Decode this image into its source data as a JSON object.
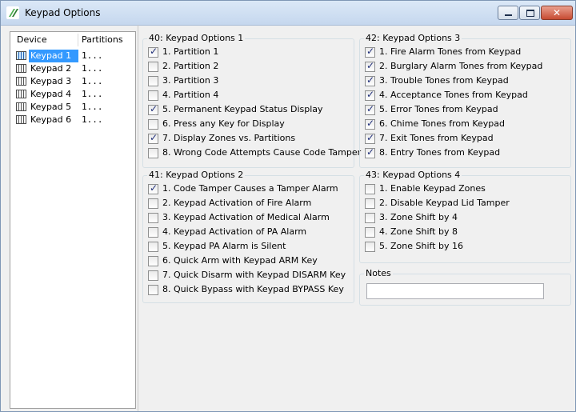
{
  "window": {
    "title": "Keypad Options"
  },
  "device_list": {
    "headers": {
      "device": "Device",
      "partitions": "Partitions"
    },
    "rows": [
      {
        "name": "Keypad 1",
        "partitions": "1...",
        "selected": true
      },
      {
        "name": "Keypad 2",
        "partitions": "1...",
        "selected": false
      },
      {
        "name": "Keypad 3",
        "partitions": "1...",
        "selected": false
      },
      {
        "name": "Keypad 4",
        "partitions": "1...",
        "selected": false
      },
      {
        "name": "Keypad 5",
        "partitions": "1...",
        "selected": false
      },
      {
        "name": "Keypad 6",
        "partitions": "1...",
        "selected": false
      }
    ]
  },
  "groups": {
    "g40": {
      "title": "40: Keypad Options 1",
      "options": [
        {
          "label": "1. Partition 1",
          "checked": true
        },
        {
          "label": "2. Partition 2",
          "checked": false
        },
        {
          "label": "3. Partition 3",
          "checked": false
        },
        {
          "label": "4. Partition 4",
          "checked": false
        },
        {
          "label": "5. Permanent Keypad Status Display",
          "checked": true
        },
        {
          "label": "6. Press any Key for Display",
          "checked": false
        },
        {
          "label": "7. Display Zones vs. Partitions",
          "checked": true
        },
        {
          "label": "8. Wrong Code Attempts Cause Code Tamper",
          "checked": false
        }
      ]
    },
    "g41": {
      "title": "41: Keypad Options 2",
      "options": [
        {
          "label": "1. Code Tamper Causes a Tamper Alarm",
          "checked": true
        },
        {
          "label": "2. Keypad Activation of Fire Alarm",
          "checked": false
        },
        {
          "label": "3. Keypad Activation of Medical Alarm",
          "checked": false
        },
        {
          "label": "4. Keypad Activation of PA Alarm",
          "checked": false
        },
        {
          "label": "5. Keypad PA Alarm is Silent",
          "checked": false
        },
        {
          "label": "6. Quick Arm with Keypad ARM Key",
          "checked": false
        },
        {
          "label": "7. Quick Disarm with Keypad DISARM Key",
          "checked": false
        },
        {
          "label": "8. Quick Bypass with Keypad BYPASS Key",
          "checked": false
        }
      ]
    },
    "g42": {
      "title": "42: Keypad Options 3",
      "options": [
        {
          "label": "1. Fire Alarm Tones from Keypad",
          "checked": true
        },
        {
          "label": "2. Burglary Alarm Tones from Keypad",
          "checked": true
        },
        {
          "label": "3. Trouble Tones from Keypad",
          "checked": true
        },
        {
          "label": "4. Acceptance Tones from Keypad",
          "checked": true
        },
        {
          "label": "5. Error Tones from Keypad",
          "checked": true
        },
        {
          "label": "6. Chime Tones from Keypad",
          "checked": true
        },
        {
          "label": "7. Exit Tones from Keypad",
          "checked": true
        },
        {
          "label": "8. Entry Tones from Keypad",
          "checked": true
        }
      ]
    },
    "g43": {
      "title": "43: Keypad Options 4",
      "options": [
        {
          "label": "1. Enable Keypad Zones",
          "checked": false
        },
        {
          "label": "2. Disable Keypad Lid Tamper",
          "checked": false
        },
        {
          "label": "3. Zone Shift by 4",
          "checked": false
        },
        {
          "label": "4. Zone Shift by 8",
          "checked": false
        },
        {
          "label": "5. Zone Shift by 16",
          "checked": false
        }
      ]
    }
  },
  "notes": {
    "label": "Notes",
    "value": ""
  },
  "colors": {
    "selection": "#3399ff",
    "title_bar": "#c5d7ee",
    "close_button": "#c74b32"
  }
}
